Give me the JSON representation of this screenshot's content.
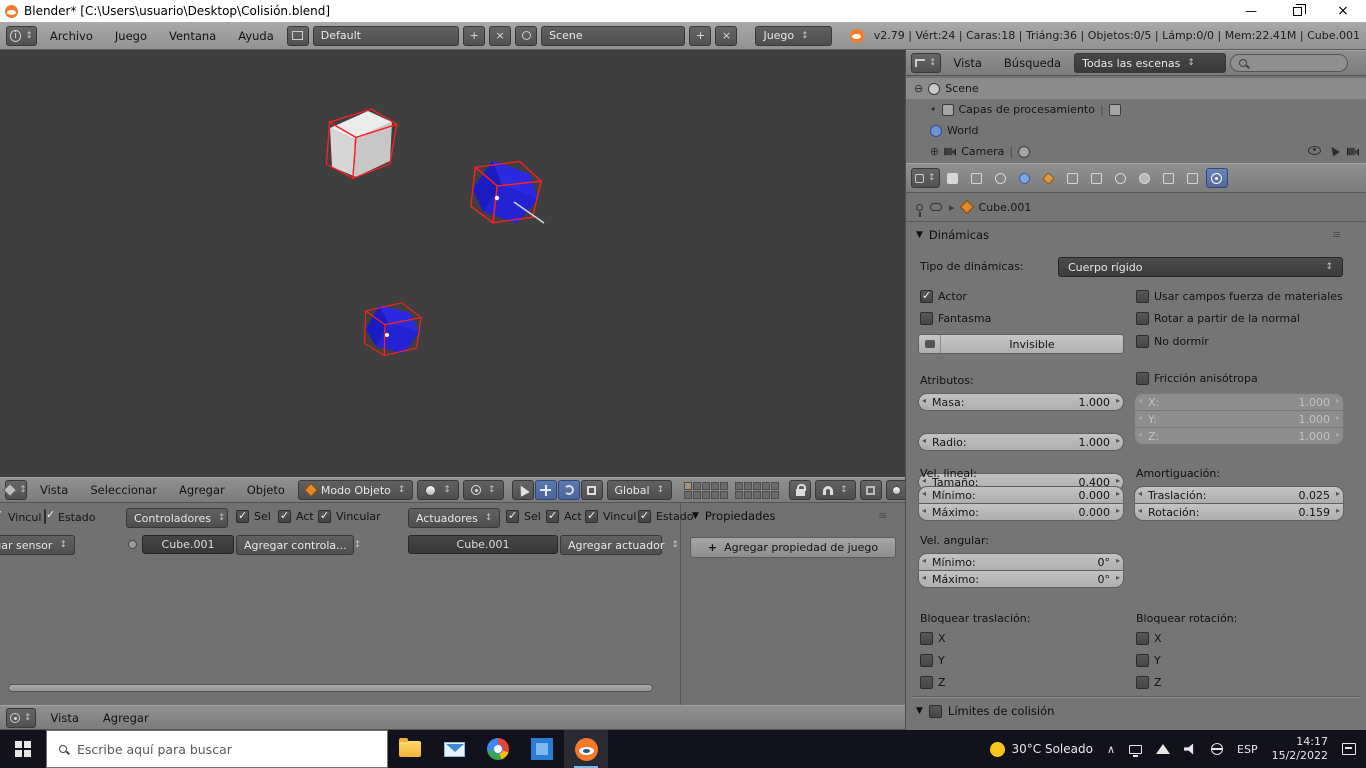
{
  "icons": {
    "min": "—",
    "close": "×",
    "tri": "▼",
    "hamburger": "≡",
    "arrow": "▸",
    "sep": "|",
    "chevron": "∧",
    "plus": "+",
    "exp_open": "⊖",
    "exp_closed": "⊕",
    "dot": "•"
  },
  "titlebar": {
    "title": "Blender* [C:\\Users\\usuario\\Desktop\\Colisión.blend]"
  },
  "header": {
    "menus": [
      "Archivo",
      "Juego",
      "Ventana",
      "Ayuda"
    ],
    "layout": "Default",
    "scene": "Scene",
    "engine": "Juego",
    "stats": "v2.79 | Vért:24 | Caras:18 | Triáng:36 | Objetos:0/5 | Lámp:0/0 | Mem:22.41M | Cube.001"
  },
  "vheader": {
    "menus": [
      "Vista",
      "Seleccionar",
      "Agregar",
      "Objeto"
    ],
    "mode": "Modo Objeto",
    "orientation": "Global"
  },
  "outliner": {
    "menu_vista": "Vista",
    "menu_busqueda": "Búsqueda",
    "scope": "Todas las escenas",
    "rows": [
      {
        "label": "Scene"
      },
      {
        "label": "Capas de procesamiento"
      },
      {
        "label": "World"
      },
      {
        "label": "Camera"
      }
    ]
  },
  "props": {
    "breadcrumb_object": "Cube.001",
    "dynamics": {
      "title": "Dinámicas",
      "type_label": "Tipo de dinámicas:",
      "type_value": "Cuerpo rígido",
      "actor": "Actor",
      "ghost": "Fantasma",
      "invisible": "Invisible",
      "use_material_force": "Usar campos fuerza de materiales",
      "rotate_from_normal": "Rotar a partir de la normal",
      "no_sleeping": "No dormir",
      "attributes": "Atributos:",
      "mass_label": "Masa:",
      "mass": "1.000",
      "radius_label": "Radio:",
      "radius": "1.000",
      "size_label": "Tamaño:",
      "size": "0.400",
      "anisotropic": "Fricción anisótropa",
      "ax": "X:",
      "ax_v": "1.000",
      "ay": "Y:",
      "ay_v": "1.000",
      "az": "Z:",
      "az_v": "1.000",
      "linvel": "Vel. lineal:",
      "min_label": "Mínimo:",
      "min_v": "0.000",
      "max_label": "Máximo:",
      "max_v": "0.000",
      "damping": "Amortiguación:",
      "trans_label": "Traslación:",
      "trans_v": "0.025",
      "rot_label": "Rotación:",
      "rot_v": "0.159",
      "angvel": "Vel. angular:",
      "amin_v": "0°",
      "amax_v": "0°",
      "lock_trans": "Bloquear traslación:",
      "lock_rot": "Bloquear rotación:",
      "x": "X",
      "y": "Y",
      "z": "Z"
    },
    "collision": {
      "title": "Límites de colisión"
    }
  },
  "logic": {
    "sens_vincul": "Vincul",
    "sens_estado": "Estado",
    "controllers": "Controladores",
    "sel": "Sel",
    "act": "Act",
    "vincular": "Vincular",
    "actuators": "Actuadores",
    "vincul": "Vincul",
    "estado": "Estado",
    "add_sensor": "Agregar sensor",
    "obj": "Cube.001",
    "add_controller": "Agregar controla...",
    "add_actuator": "Agregar actuador",
    "properties_title": "Propiedades",
    "add_game_prop": "Agregar propiedad de juego",
    "footer_vista": "Vista",
    "footer_agregar": "Agregar"
  },
  "taskbar": {
    "search": "Escribe aquí para buscar",
    "weather": "30°C Soleado",
    "lang": "ESP",
    "time": "14:17",
    "date": "15/2/2022"
  }
}
